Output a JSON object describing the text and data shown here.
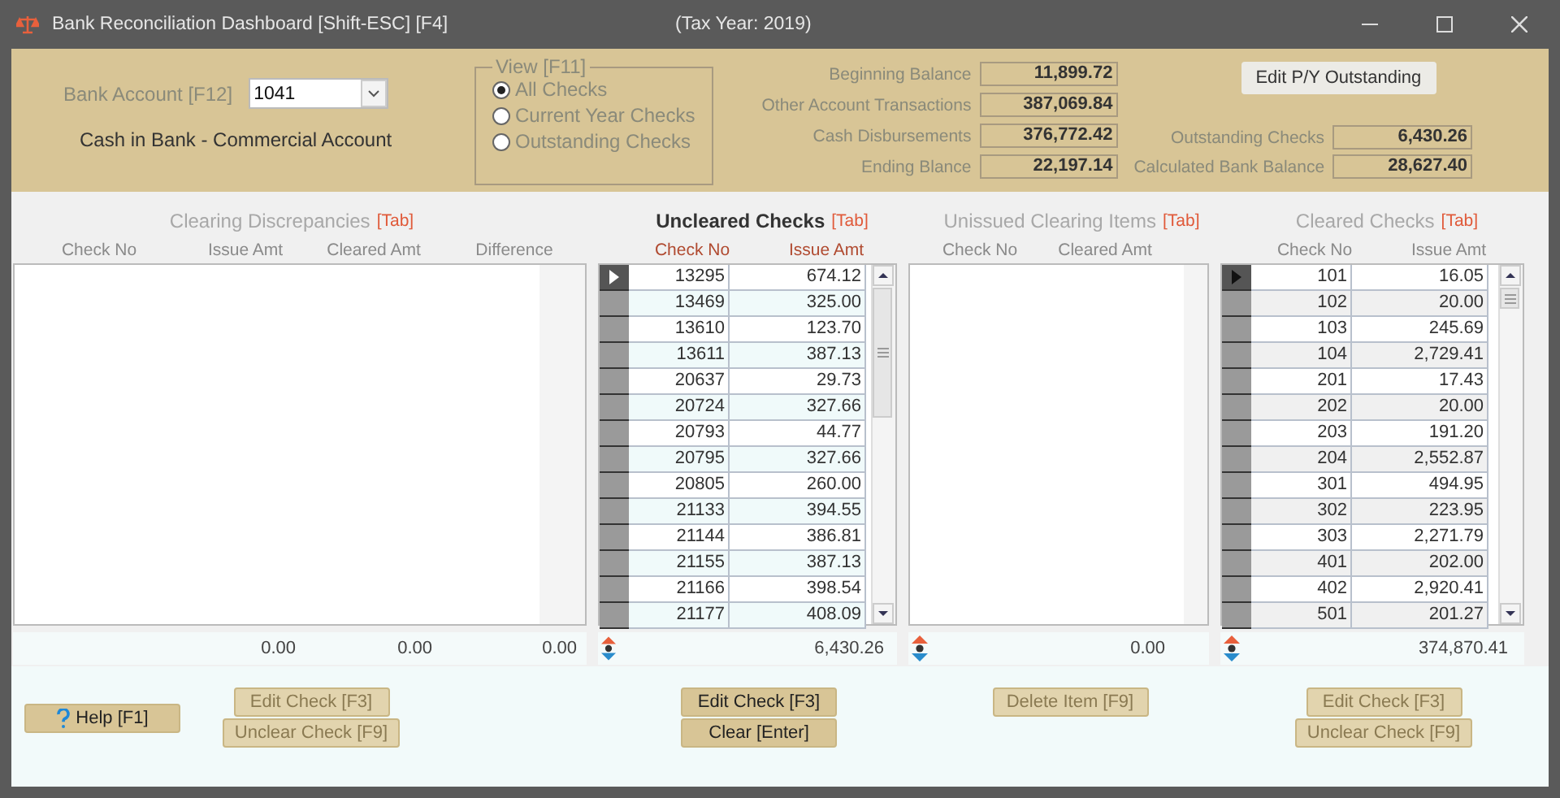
{
  "window": {
    "title": "Bank Reconciliation Dashboard [Shift-ESC] [F4]",
    "tax_year": "(Tax Year: 2019)"
  },
  "header": {
    "bank_account": {
      "label": "Bank Account [F12]",
      "value": "1041"
    },
    "account_name": "Cash in Bank - Commercial Account",
    "view": {
      "title": "View [F11]",
      "options": [
        {
          "label": "All Checks",
          "selected": true
        },
        {
          "label": "Current Year Checks",
          "selected": false
        },
        {
          "label": "Outstanding Checks",
          "selected": false
        }
      ]
    },
    "balances": [
      {
        "label": "Beginning Balance",
        "value": "11,899.72"
      },
      {
        "label": "Other Account Transactions",
        "value": "387,069.84"
      },
      {
        "label": "Cash Disbursements",
        "value": "376,772.42"
      },
      {
        "label": "Ending Blance",
        "value": "22,197.14"
      }
    ],
    "edit_button": "Edit P/Y Outstanding",
    "bank_totals": [
      {
        "label": "Outstanding Checks",
        "value": "6,430.26"
      },
      {
        "label": "Calculated Bank Balance",
        "value": "28,627.40"
      }
    ]
  },
  "help_button": "Help [F1]",
  "panels": [
    {
      "title": "Clearing Discrepancies",
      "hotkey": "[Tab]",
      "active": false,
      "columns": [
        "Check No",
        "Issue Amt",
        "Cleared Amt",
        "Difference"
      ],
      "totals": [
        "0.00",
        "0.00",
        "0.00"
      ],
      "buttons": [
        {
          "label": "Edit Check [F3]",
          "disabled": true
        },
        {
          "label": "Unclear Check [F9]",
          "disabled": true
        }
      ]
    },
    {
      "title": "Uncleared Checks",
      "hotkey": "[Tab]",
      "active": true,
      "columns": [
        "Check No",
        "Issue Amt"
      ],
      "totals": [
        "6,430.26"
      ],
      "rows": [
        {
          "cells": [
            "13295",
            "674.12"
          ],
          "selected": true
        },
        {
          "cells": [
            "13469",
            "325.00"
          ],
          "selected": false
        },
        {
          "cells": [
            "13610",
            "123.70"
          ],
          "selected": false
        },
        {
          "cells": [
            "13611",
            "387.13"
          ],
          "selected": false
        },
        {
          "cells": [
            "20637",
            "29.73"
          ],
          "selected": false
        },
        {
          "cells": [
            "20724",
            "327.66"
          ],
          "selected": false
        },
        {
          "cells": [
            "20793",
            "44.77"
          ],
          "selected": false
        },
        {
          "cells": [
            "20795",
            "327.66"
          ],
          "selected": false
        },
        {
          "cells": [
            "20805",
            "260.00"
          ],
          "selected": false
        },
        {
          "cells": [
            "21133",
            "394.55"
          ],
          "selected": false
        },
        {
          "cells": [
            "21144",
            "386.81"
          ],
          "selected": false
        },
        {
          "cells": [
            "21155",
            "387.13"
          ],
          "selected": false
        },
        {
          "cells": [
            "21166",
            "398.54"
          ],
          "selected": false
        },
        {
          "cells": [
            "21177",
            "408.09"
          ],
          "selected": false
        }
      ],
      "buttons": [
        {
          "label": "Edit Check [F3]",
          "disabled": false
        },
        {
          "label": "Clear [Enter]",
          "disabled": false
        }
      ]
    },
    {
      "title": "Unissued Clearing Items",
      "hotkey": "[Tab]",
      "active": false,
      "columns": [
        "Check No",
        "Cleared Amt"
      ],
      "totals": [
        "0.00"
      ],
      "buttons": [
        {
          "label": "Delete Item [F9]",
          "disabled": true
        }
      ]
    },
    {
      "title": "Cleared Checks",
      "hotkey": "[Tab]",
      "active": false,
      "columns": [
        "Check No",
        "Issue Amt"
      ],
      "totals": [
        "374,870.41"
      ],
      "rows": [
        {
          "cells": [
            "101",
            "16.05"
          ],
          "selected": true
        },
        {
          "cells": [
            "102",
            "20.00"
          ],
          "selected": false
        },
        {
          "cells": [
            "103",
            "245.69"
          ],
          "selected": false
        },
        {
          "cells": [
            "104",
            "2,729.41"
          ],
          "selected": false
        },
        {
          "cells": [
            "201",
            "17.43"
          ],
          "selected": false
        },
        {
          "cells": [
            "202",
            "20.00"
          ],
          "selected": false
        },
        {
          "cells": [
            "203",
            "191.20"
          ],
          "selected": false
        },
        {
          "cells": [
            "204",
            "2,552.87"
          ],
          "selected": false
        },
        {
          "cells": [
            "301",
            "494.95"
          ],
          "selected": false
        },
        {
          "cells": [
            "302",
            "223.95"
          ],
          "selected": false
        },
        {
          "cells": [
            "303",
            "2,271.79"
          ],
          "selected": false
        },
        {
          "cells": [
            "401",
            "202.00"
          ],
          "selected": false
        },
        {
          "cells": [
            "402",
            "2,920.41"
          ],
          "selected": false
        },
        {
          "cells": [
            "501",
            "201.27"
          ],
          "selected": false
        }
      ],
      "buttons": [
        {
          "label": "Edit Check [F3]",
          "disabled": true
        },
        {
          "label": "Unclear Check [F9]",
          "disabled": true
        }
      ]
    }
  ]
}
